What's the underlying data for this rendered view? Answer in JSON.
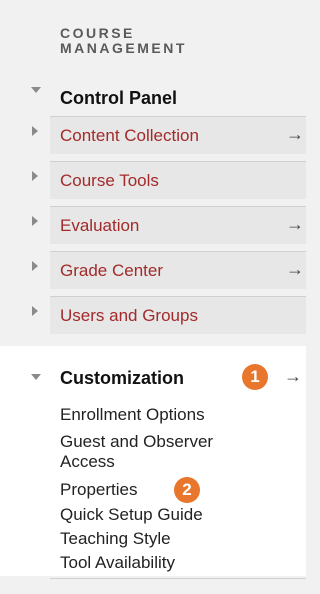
{
  "section_title": {
    "line1": "COURSE",
    "line2": "MANAGEMENT"
  },
  "control_panel": {
    "label": "Control Panel",
    "items": [
      {
        "label": "Content Collection",
        "arrow": "→"
      },
      {
        "label": "Course Tools",
        "arrow": ""
      },
      {
        "label": "Evaluation",
        "arrow": "→"
      },
      {
        "label": "Grade Center",
        "arrow": "→"
      },
      {
        "label": "Users and Groups",
        "arrow": ""
      }
    ]
  },
  "customization": {
    "label": "Customization",
    "arrow": "→",
    "badge": "1",
    "items": [
      {
        "label": "Enrollment Options"
      },
      {
        "label": "Guest and Observer Access"
      },
      {
        "label": "Properties",
        "badge": "2"
      },
      {
        "label": "Quick Setup Guide"
      },
      {
        "label": "Teaching Style"
      },
      {
        "label": "Tool Availability"
      }
    ]
  },
  "colors": {
    "link": "#a32a2a",
    "badge": "#e8762c",
    "panel": "#e7e7e7"
  }
}
